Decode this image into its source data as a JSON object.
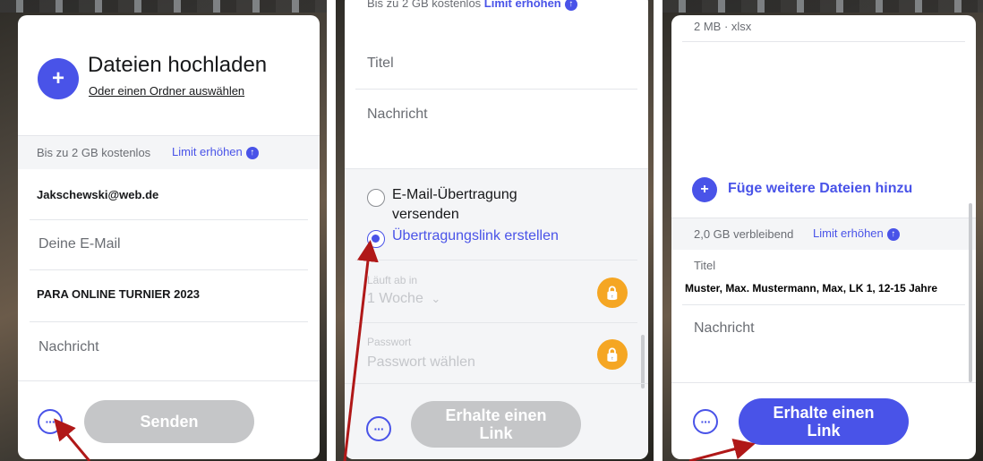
{
  "panel1": {
    "upload_title": "Dateien hochladen",
    "folder_link": "Oder einen Ordner auswählen",
    "plus_symbol": "+",
    "limit_text": "Bis zu 2 GB kostenlos",
    "limit_link": "Limit erhöhen",
    "to_value": "Jakschewski@web.de",
    "email_placeholder": "Deine E-Mail",
    "title_value": "PARA ONLINE TURNIER 2023",
    "message_placeholder": "Nachricht",
    "more_symbol": "···",
    "send_button": "Senden"
  },
  "panel2": {
    "limit_text_partial": "Bis zu 2 GB kostenlos",
    "limit_link": "Limit erhöhen",
    "title_placeholder": "Titel",
    "message_placeholder": "Nachricht",
    "option_email": "E-Mail-Übertragung versenden",
    "option_link": "Übertragungslink erstellen",
    "expiry_label": "Läuft ab in",
    "expiry_value": "1 Woche",
    "password_label": "Passwort",
    "password_placeholder": "Passwort wählen",
    "more_symbol": "···",
    "get_link_button": "Erhalte einen Link"
  },
  "panel3": {
    "file_info": "2 MB · xlsx",
    "add_files": "Füge weitere Dateien hinzu",
    "plus_symbol": "+",
    "remaining": "2,0 GB verbleibend",
    "limit_link": "Limit erhöhen",
    "title_label": "Titel",
    "title_value": "Muster, Max. Mustermann, Max, LK 1, 12-15 Jahre",
    "message_placeholder": "Nachricht",
    "more_symbol": "···",
    "get_link_button": "Erhalte einen Link"
  },
  "icons": {
    "chevron": "⌄",
    "lock": "🔒",
    "up_arrow": "↑"
  },
  "colors": {
    "accent": "#4953e8",
    "disabled_button": "#c5c6c8",
    "lock_badge": "#f5a623",
    "annotation_arrow": "#b01818"
  }
}
